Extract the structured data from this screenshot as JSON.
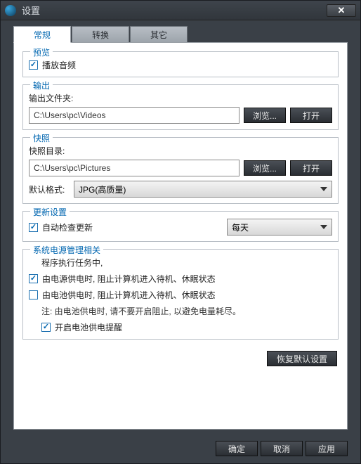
{
  "window": {
    "title": "设置"
  },
  "tabs": {
    "general": "常规",
    "convert": "转换",
    "other": "其它"
  },
  "preview": {
    "legend": "预览",
    "play_audio": "播放音频"
  },
  "output": {
    "legend": "输出",
    "folder_label": "输出文件夹:",
    "folder_value": "C:\\Users\\pc\\Videos",
    "browse": "浏览...",
    "open": "打开"
  },
  "snapshot": {
    "legend": "快照",
    "dir_label": "快照目录:",
    "dir_value": "C:\\Users\\pc\\Pictures",
    "browse": "浏览...",
    "open": "打开",
    "format_label": "默认格式:",
    "format_value": "JPG(高质量)"
  },
  "update": {
    "legend": "更新设置",
    "auto_check": "自动检查更新",
    "interval": "每天"
  },
  "power": {
    "legend": "系统电源管理相关",
    "running": "程序执行任务中,",
    "ac": "由电源供电时, 阻止计算机进入待机、休眠状态",
    "battery": "由电池供电时, 阻止计算机进入待机、休眠状态",
    "note": "注:  由电池供电时, 请不要开启阻止, 以避免电量耗尽。",
    "reminder": "开启电池供电提醒"
  },
  "restore": "恢复默认设置",
  "footer": {
    "ok": "确定",
    "cancel": "取消",
    "apply": "应用"
  }
}
